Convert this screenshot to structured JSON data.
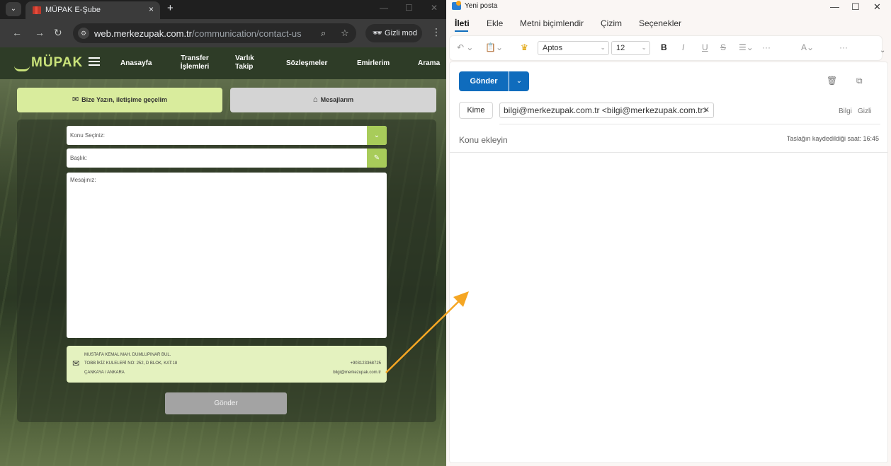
{
  "browser": {
    "tab_title": "MÜPAK E-Şube",
    "tab_close": "×",
    "new_tab": "+",
    "url_host": "web.merkezupak.com.tr",
    "url_path": "/communication/contact-us",
    "incognito_label": "Gizli mod",
    "icons": [
      "back-icon",
      "forward-icon",
      "reload-icon",
      "site-info-icon",
      "zoom-icon",
      "star-icon",
      "incognito-icon",
      "menu-icon"
    ]
  },
  "site": {
    "logo": "MÜPAK",
    "nav": [
      "Anasayfa",
      "Transfer İşlemleri",
      "Varlık Takip",
      "Sözleşmeler",
      "Emirlerim",
      "Arama"
    ],
    "btn_write": "Bize Yazın, iletişime geçelim",
    "btn_messages": "Mesajlarım",
    "subject_placeholder": "Konu Seçiniz:",
    "title_placeholder": "Başlık:",
    "message_placeholder": "Mesajınız:",
    "address_lines": [
      "MUSTAFA KEMAL MAH. DUMLUPINAR BUL.",
      "TOBB İKİZ KULELERİ NO: 252, D BLOK, KAT:18",
      "ÇANKAYA / ANKARA"
    ],
    "phone": "+903123368725",
    "email": "bilgi@merkezupak.com.tr",
    "submit": "Gönder"
  },
  "mail": {
    "window_title": "Yeni posta",
    "ribbon_tabs": [
      "İleti",
      "Ekle",
      "Metni biçimlendir",
      "Çizim",
      "Seçenekler"
    ],
    "font_name": "Aptos",
    "font_size": "12",
    "send_label": "Gönder",
    "to_label": "Kime",
    "recipient": "bilgi@merkezupak.com.tr <bilgi@merkezupak.com.tr>",
    "cc_label": "Bilgi",
    "bcc_label": "Gizli",
    "subject_placeholder": "Konu ekleyin",
    "draft_saved": "Taslağın kaydedildiği saat: 16:45",
    "accent_color": "#0f6cbd",
    "annotation_arrow_color": "#f5a623"
  }
}
